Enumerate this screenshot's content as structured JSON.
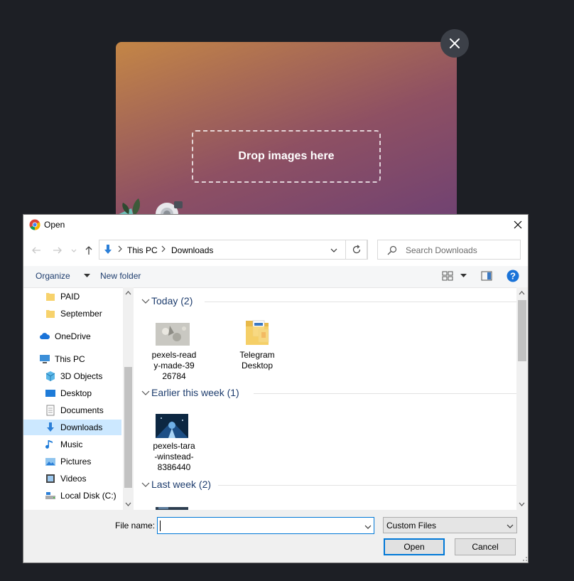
{
  "upload": {
    "drop_label": "Drop images here"
  },
  "dialog": {
    "title": "Open",
    "breadcrumb": [
      "This PC",
      "Downloads"
    ],
    "search_placeholder": "Search Downloads",
    "toolbar": {
      "organize": "Organize",
      "new_folder": "New folder"
    },
    "nav_items": [
      {
        "label": "PAID",
        "icon": "folder-icon"
      },
      {
        "label": "September",
        "icon": "folder-icon"
      },
      {
        "label": "OneDrive",
        "icon": "cloud-icon"
      },
      {
        "label": "This PC",
        "icon": "computer-icon"
      },
      {
        "label": "3D Objects",
        "icon": "cube-icon"
      },
      {
        "label": "Desktop",
        "icon": "desktop-icon"
      },
      {
        "label": "Documents",
        "icon": "document-icon"
      },
      {
        "label": "Downloads",
        "icon": "download-icon",
        "selected": true
      },
      {
        "label": "Music",
        "icon": "music-icon"
      },
      {
        "label": "Pictures",
        "icon": "pictures-icon"
      },
      {
        "label": "Videos",
        "icon": "videos-icon"
      },
      {
        "label": "Local Disk (C:)",
        "icon": "drive-icon"
      }
    ],
    "groups": [
      {
        "label": "Today (2)",
        "files": [
          {
            "name_lines": [
              "pexels-read",
              "y-made-39",
              "26784"
            ],
            "type": "image"
          },
          {
            "name_lines": [
              "Telegram",
              "Desktop"
            ],
            "type": "folder"
          }
        ]
      },
      {
        "label": "Earlier this week (1)",
        "files": [
          {
            "name_lines": [
              "pexels-tara",
              "-winstead-",
              "8386440"
            ],
            "type": "image"
          }
        ]
      },
      {
        "label": "Last week (2)",
        "files": []
      }
    ],
    "file_name_label": "File name:",
    "file_name_value": "",
    "file_type": "Custom Files",
    "open_button": "Open",
    "cancel_button": "Cancel"
  }
}
